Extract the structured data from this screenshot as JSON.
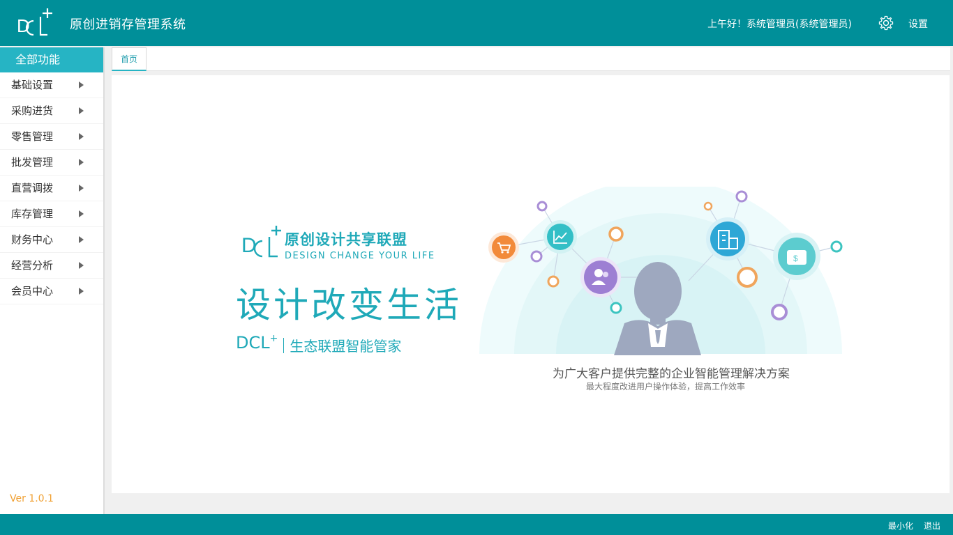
{
  "header": {
    "title": "原创进销存管理系统",
    "greeting": "上午好！系统管理员(系统管理员)",
    "settings_label": "设置",
    "logo_text": "DCL+"
  },
  "sidebar": {
    "heading": "全部功能",
    "items": [
      {
        "label": "基础设置"
      },
      {
        "label": "采购进货"
      },
      {
        "label": "零售管理"
      },
      {
        "label": "批发管理"
      },
      {
        "label": "直营调拨"
      },
      {
        "label": "库存管理"
      },
      {
        "label": "财务中心"
      },
      {
        "label": "经营分析"
      },
      {
        "label": "会员中心"
      }
    ],
    "version": "Ver 1.0.1"
  },
  "tabs": [
    {
      "label": "首页",
      "active": true
    }
  ],
  "banner": {
    "brand_cn": "原创设计共享联盟",
    "brand_en": "DESIGN CHANGE YOUR LIFE",
    "slogan": "设计改变生活",
    "dcl": "DCL",
    "dcl_plus": "+",
    "dcl_sub": "生态联盟智能管家",
    "caption_main": "为广大客户提供完整的企业智能管理解决方案",
    "caption_sub": "最大程度改进用户操作体验，提高工作效率"
  },
  "footer": {
    "minimize_label": "最小化",
    "exit_label": "退出"
  },
  "colors": {
    "header_bg": "#008f99",
    "accent": "#26b4c4",
    "brand_text": "#1fa9b8",
    "version_text": "#f0a032"
  }
}
